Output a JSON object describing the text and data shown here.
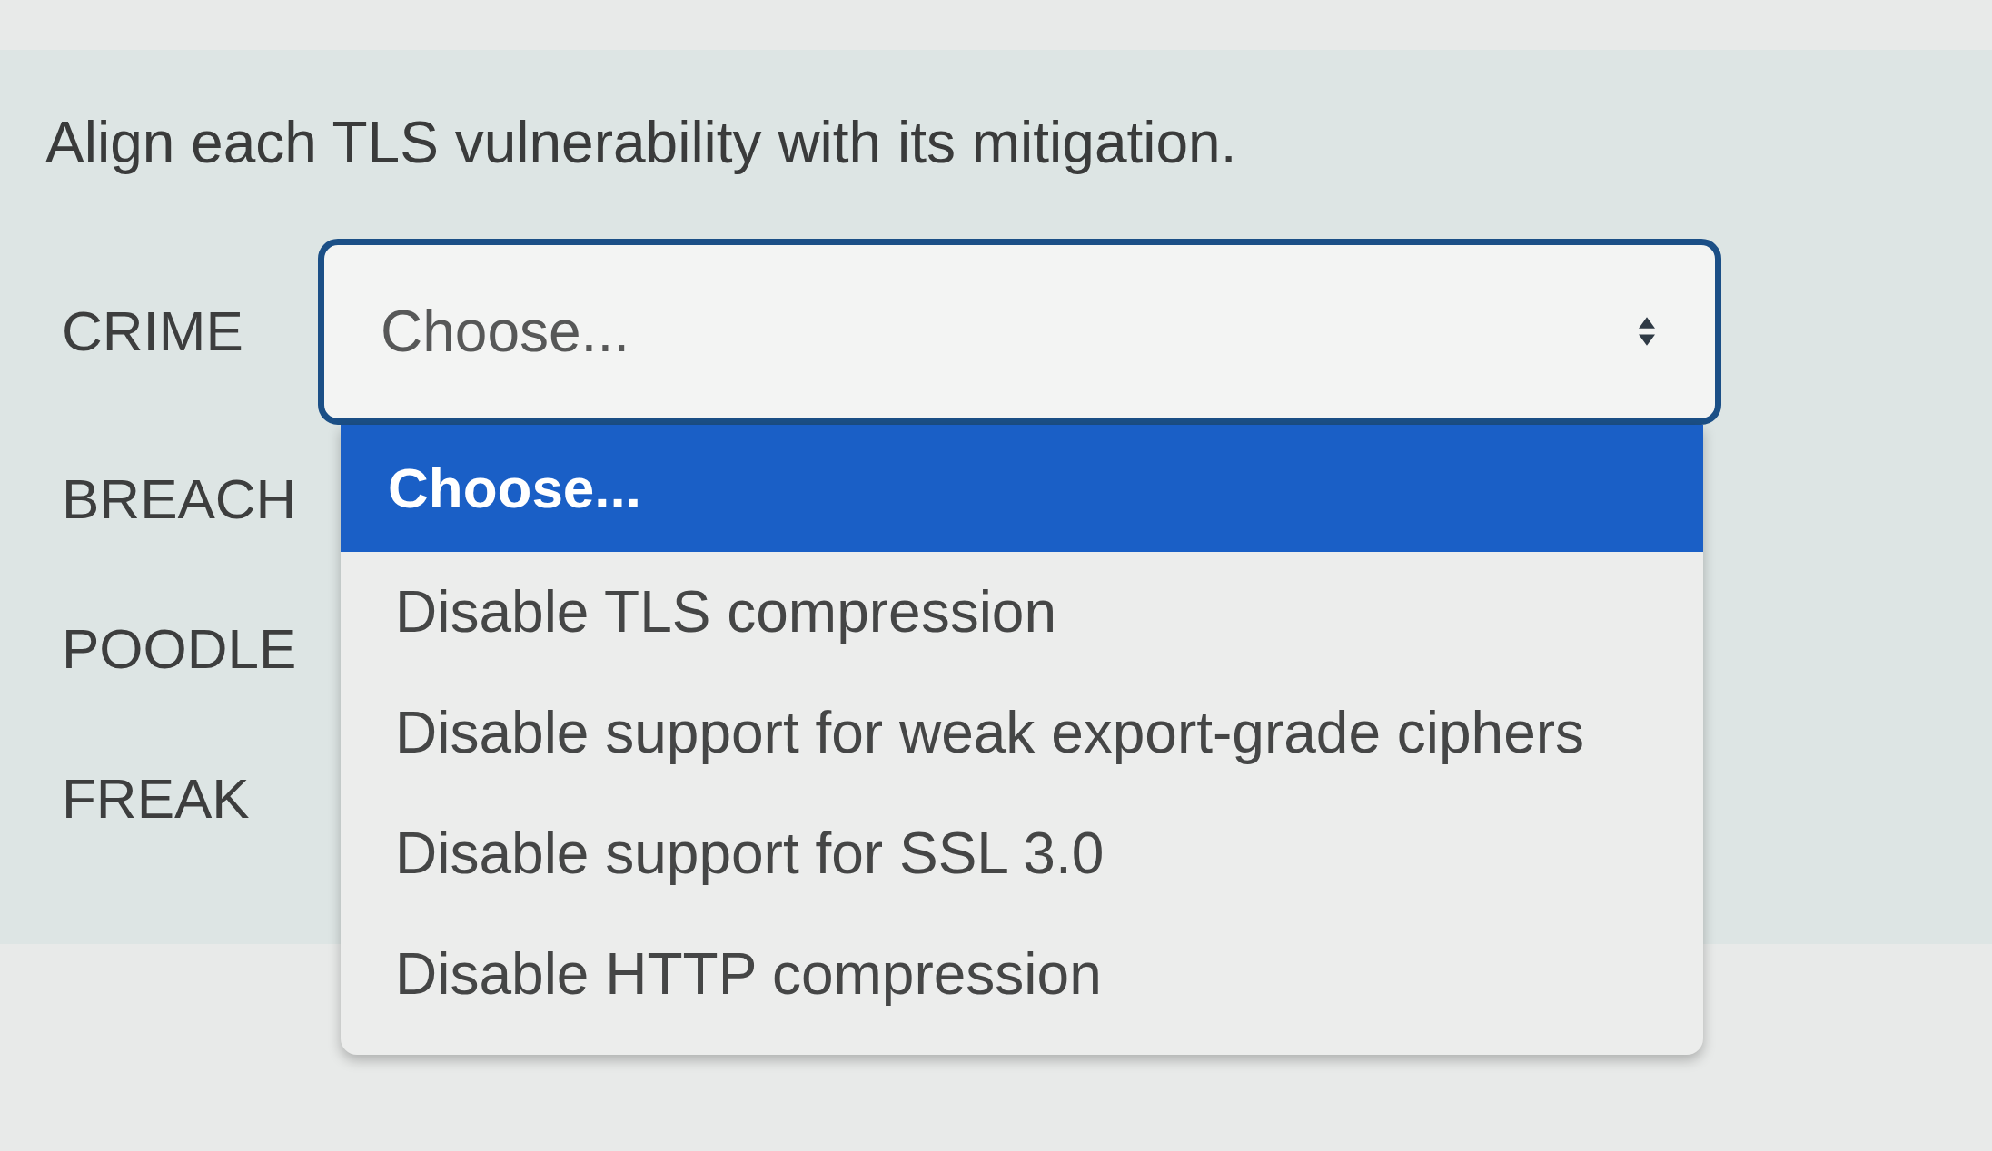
{
  "prompt": "Align each TLS vulnerability with its mitigation.",
  "rows": [
    {
      "label": "CRIME",
      "select": {
        "value": "Choose...",
        "open": true,
        "options": [
          {
            "label": "Choose...",
            "selected": true
          },
          {
            "label": "Disable TLS compression",
            "selected": false
          },
          {
            "label": "Disable support for weak export-grade ciphers",
            "selected": false
          },
          {
            "label": "Disable support for SSL 3.0",
            "selected": false
          },
          {
            "label": "Disable HTTP compression",
            "selected": false
          }
        ]
      }
    },
    {
      "label": "BREACH"
    },
    {
      "label": "POODLE"
    },
    {
      "label": "FREAK"
    }
  ]
}
